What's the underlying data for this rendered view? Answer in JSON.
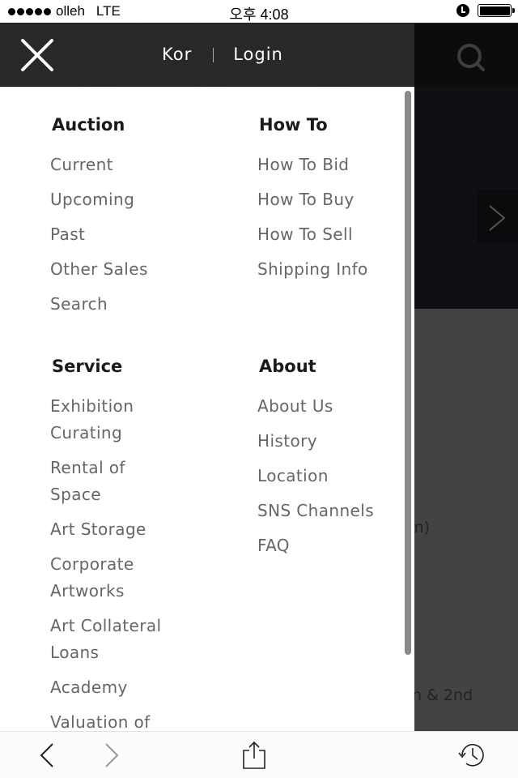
{
  "status_bar": {
    "carrier": "olleh",
    "network": "LTE",
    "time": "오후 4:08",
    "signal_dots": 5,
    "icons": [
      "alarm-icon",
      "battery-icon"
    ],
    "battery_level": 1.0
  },
  "drawer": {
    "header": {
      "close_icon": "close-icon",
      "language_label": "Kor",
      "login_label": "Login"
    },
    "sections": {
      "auction": {
        "heading": "Auction",
        "items": [
          "Current",
          "Upcoming",
          "Past",
          "Other Sales",
          "Search"
        ]
      },
      "howto": {
        "heading": "How To",
        "items": [
          "How To Bid",
          "How To Buy",
          "How To Sell",
          "Shipping Info"
        ]
      },
      "service": {
        "heading": "Service",
        "items": [
          "Exhibition Curating",
          "Rental of Space",
          "Art Storage",
          "Corporate Artworks",
          "Art Collateral Loans",
          "Academy",
          "Valuation of"
        ]
      },
      "about": {
        "heading": "About",
        "items": [
          "About Us",
          "History",
          "Location",
          "SNS Channels",
          "FAQ"
        ]
      }
    }
  },
  "background_page": {
    "search_icon": "search-icon",
    "next_icon": "chevron-right-icon",
    "text_fragment_1": "on)",
    "text_fragment_2": "n & 2nd"
  },
  "toolbar": {
    "back_icon": "chevron-left-icon",
    "forward_icon": "chevron-right-icon",
    "share_icon": "share-icon",
    "history_icon": "history-icon"
  },
  "colors": {
    "header_bg": "#262626",
    "heading_text": "#1a1a1a",
    "item_text": "#666666",
    "bg_page": "#434343",
    "hero_bg": "#0f1013"
  }
}
